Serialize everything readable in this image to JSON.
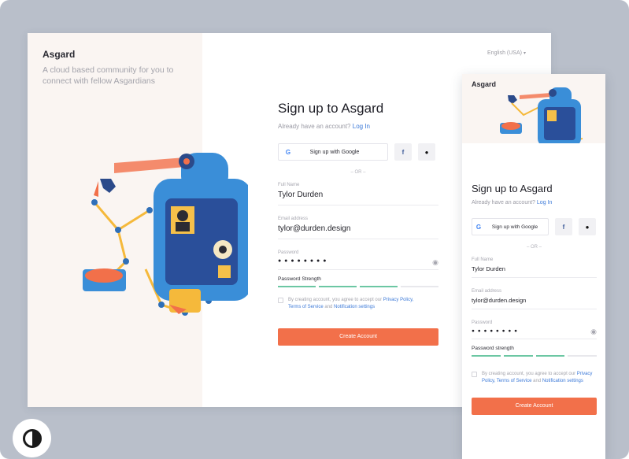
{
  "desktop": {
    "brand": "Asgard",
    "tagline": "A cloud based community for you to connect with fellow Asgardians",
    "language": "English (USA)",
    "form": {
      "title": "Sign up to Asgard",
      "have_account": "Already have an account?",
      "login_link": "Log In",
      "google_label": "Sign up with Google",
      "or_text": "– OR –",
      "fullname_label": "Full Name",
      "fullname_value": "Tylor Durden",
      "email_label": "Email address",
      "email_value": "tylor@durden.design",
      "password_label": "Password",
      "password_value": "● ● ● ● ● ● ● ●",
      "strength_label": "Password Strength",
      "strength_fraction": 0.75,
      "terms_prefix": "By creating account, you agree to accept our",
      "terms_privacy": "Privacy Policy,",
      "terms_tos": "Terms of Service",
      "terms_and": "and",
      "terms_notif": "Notification settings",
      "cta": "Create Account"
    }
  },
  "mobile": {
    "brand": "Asgard",
    "form": {
      "title": "Sign up to Asgard",
      "have_account": "Already have an account?",
      "login_link": "Log In",
      "google_label": "Sign up with Google",
      "or_text": "– OR –",
      "fullname_label": "Full Name",
      "fullname_value": "Tylor Durden",
      "email_label": "Email address",
      "email_value": "tylor@durden.design",
      "password_label": "Password",
      "password_value": "● ● ● ● ● ● ● ●",
      "strength_label": "Password strength",
      "strength_fraction": 0.75,
      "terms_prefix": "By creating account, you agree to accept our",
      "terms_privacy": "Privacy Policy,",
      "terms_tos": "Terms of Service",
      "terms_and": "and",
      "terms_notif": "Notification settings",
      "cta": "Create Account"
    }
  },
  "icons": {
    "google": "google-icon",
    "facebook": "facebook-icon",
    "apple": "apple-icon",
    "eye": "eye-icon",
    "contrast": "contrast-icon",
    "caret": "chevron-down-icon"
  },
  "colors": {
    "accent": "#f2704a",
    "link": "#3d7ad8",
    "strength": "#6cc7a3",
    "left_panel_bg": "#faf5f2",
    "backdrop": "#b9bfca"
  }
}
